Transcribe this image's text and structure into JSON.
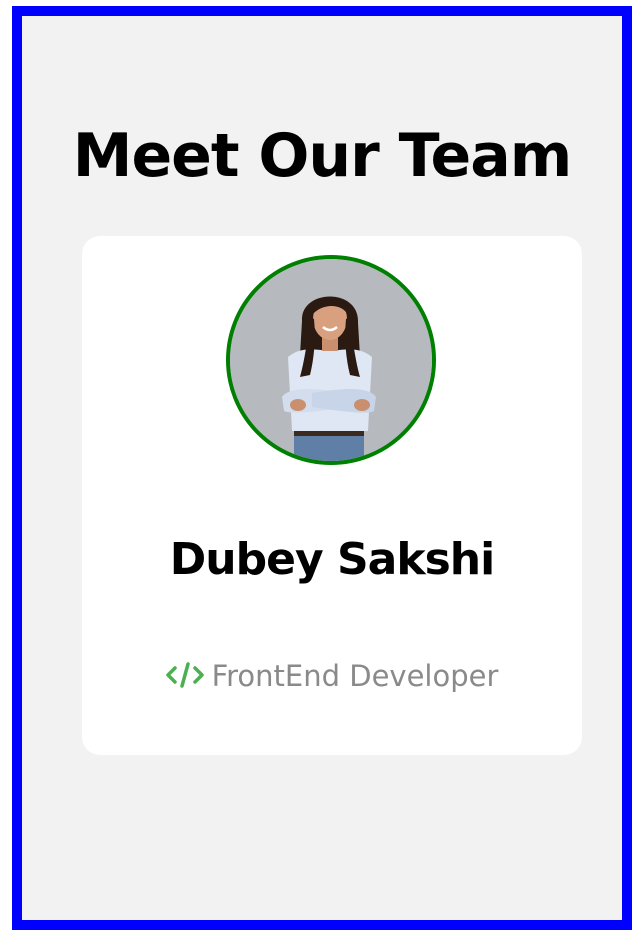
{
  "page": {
    "title": "Meet Our Team"
  },
  "member": {
    "name": "Dubey Sakshi",
    "role": "FrontEnd Developer",
    "role_icon": "code-icon",
    "avatar_icon": "profile-photo"
  },
  "colors": {
    "frame_border": "#0000ff",
    "background": "#f2f2f2",
    "card": "#ffffff",
    "avatar_ring": "#008000",
    "role_icon": "#4caf50",
    "role_text": "#8a8a8a"
  }
}
